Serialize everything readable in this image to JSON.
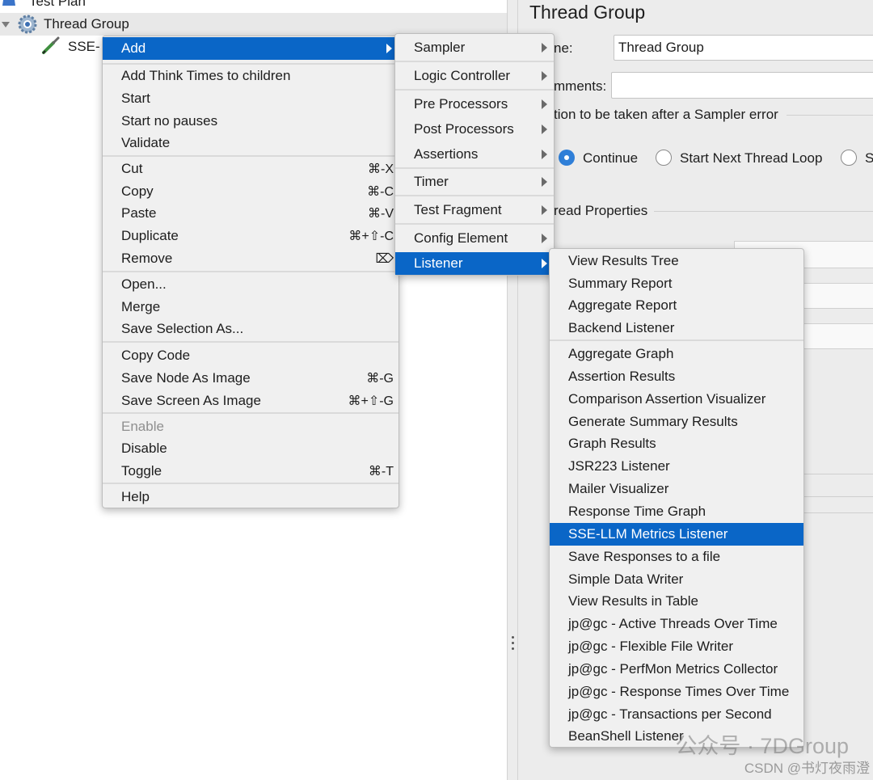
{
  "tree": {
    "test_plan_label": "Test Plan",
    "thread_group_label": "Thread Group",
    "sampler_label": "SSE-"
  },
  "right_panel": {
    "title": "Thread Group",
    "name_label": "ne:",
    "name_value": "Thread Group",
    "comments_label": "mments:",
    "comments_value": "",
    "error_action_label": "tion to be taken after a Sampler error",
    "radio_continue": "Continue",
    "radio_start_next": "Start Next Thread Loop",
    "radio_partial": "S",
    "thread_properties_label": "read Properties"
  },
  "context_menu": {
    "add": "Add",
    "add_think_times": "Add Think Times to children",
    "start": "Start",
    "start_no_pauses": "Start no pauses",
    "validate": "Validate",
    "cut": "Cut",
    "cut_shortcut": "⌘-X",
    "copy": "Copy",
    "copy_shortcut": "⌘-C",
    "paste": "Paste",
    "paste_shortcut": "⌘-V",
    "duplicate": "Duplicate",
    "duplicate_shortcut": "⌘+⇧-C",
    "remove": "Remove",
    "remove_shortcut": "⌦",
    "open": "Open...",
    "merge": "Merge",
    "save_selection_as": "Save Selection As...",
    "copy_code": "Copy Code",
    "save_node_as_image": "Save Node As Image",
    "save_node_shortcut": "⌘-G",
    "save_screen_as_image": "Save Screen As Image",
    "save_screen_shortcut": "⌘+⇧-G",
    "enable": "Enable",
    "disable": "Disable",
    "toggle": "Toggle",
    "toggle_shortcut": "⌘-T",
    "help": "Help"
  },
  "add_submenu": {
    "sampler": "Sampler",
    "logic_controller": "Logic Controller",
    "pre_processors": "Pre Processors",
    "post_processors": "Post Processors",
    "assertions": "Assertions",
    "timer": "Timer",
    "test_fragment": "Test Fragment",
    "config_element": "Config Element",
    "listener": "Listener"
  },
  "listener_submenu": {
    "group1": [
      "View Results Tree",
      "Summary Report",
      "Aggregate Report",
      "Backend Listener"
    ],
    "group2": [
      "Aggregate Graph",
      "Assertion Results",
      "Comparison Assertion Visualizer",
      "Generate Summary Results",
      "Graph Results",
      "JSR223 Listener",
      "Mailer Visualizer",
      "Response Time Graph",
      "SSE-LLM Metrics Listener",
      "Save Responses to a file",
      "Simple Data Writer",
      "View Results in Table",
      "jp@gc - Active Threads Over Time",
      "jp@gc - Flexible File Writer",
      "jp@gc - PerfMon Metrics Collector",
      "jp@gc - Response Times Over Time",
      "jp@gc - Transactions per Second",
      "BeanShell Listener"
    ],
    "highlighted": "SSE-LLM Metrics Listener"
  },
  "watermark": {
    "main": "公众号 · 7DGroup",
    "sub": "CSDN @书灯夜雨澄"
  },
  "colors": {
    "highlight": "#0a66c7",
    "radio_selected": "#2f7fd8",
    "menu_bg": "#f0f0f0",
    "panel_bg": "#ececec"
  }
}
